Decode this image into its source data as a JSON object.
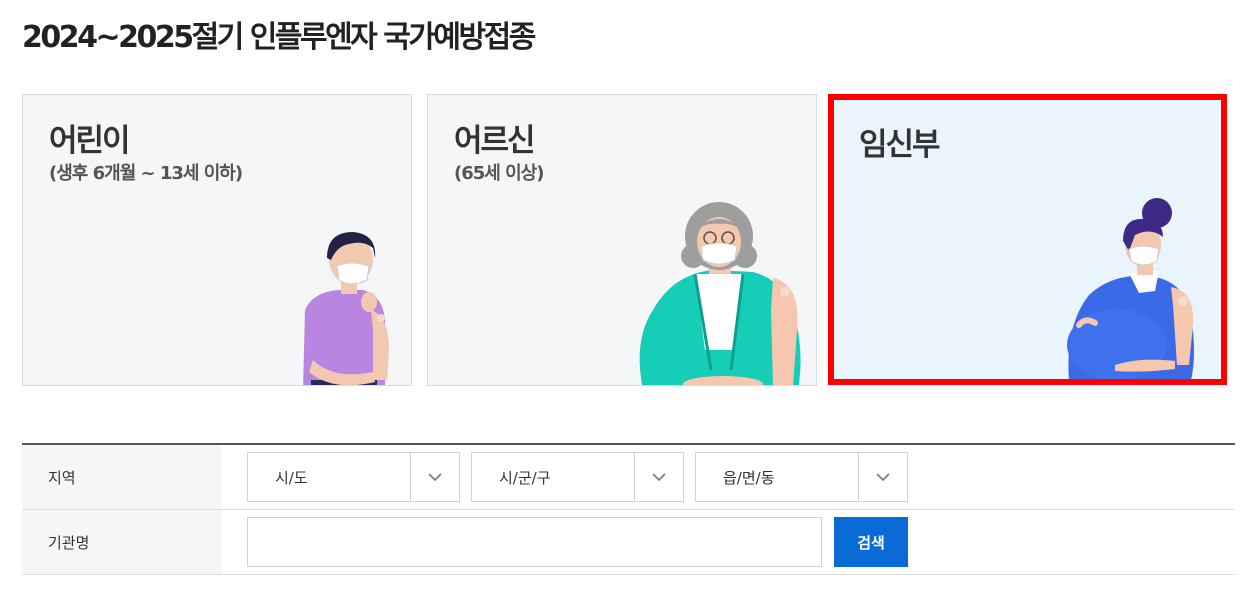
{
  "page": {
    "title": "2024~2025절기 인플루엔자 국가예방접종"
  },
  "cards": [
    {
      "title": "어린이",
      "subtitle": "(생후 6개월 ~ 13세 이하)"
    },
    {
      "title": "어르신",
      "subtitle": "(65세 이상)"
    },
    {
      "title": "임신부",
      "subtitle": ""
    }
  ],
  "search": {
    "region_label": "지역",
    "selects": [
      "시/도",
      "시/군/구",
      "읍/면/동"
    ],
    "institution_label": "기관명",
    "institution_value": "",
    "search_button": "검색"
  },
  "icons": [
    "chevron-down-icon"
  ],
  "colors": {
    "accent": "#0b6bd6",
    "highlight_border": "#ff0000"
  }
}
